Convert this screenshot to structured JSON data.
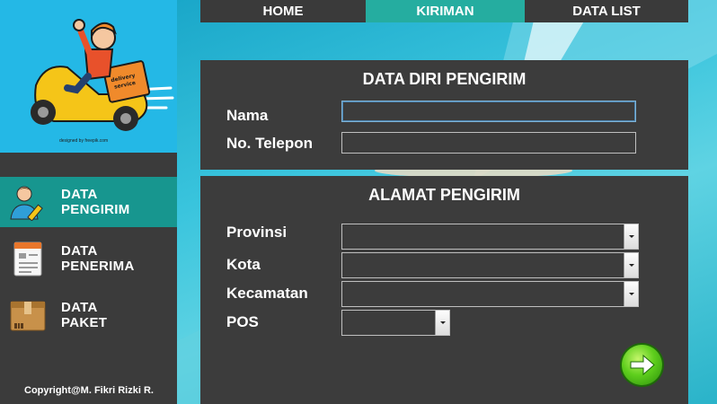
{
  "nav": {
    "tabs": [
      {
        "label": "HOME"
      },
      {
        "label": "KIRIMAN"
      },
      {
        "label": "DATA LIST"
      }
    ],
    "active_tab": "KIRIMAN"
  },
  "sidebar": {
    "hero": {
      "box_text": "delivery\nservice",
      "credit": "designed by freepik.com"
    },
    "items": [
      {
        "label": "DATA\nPENGIRIM",
        "icon": "user-edit-icon",
        "active": true
      },
      {
        "label": "DATA\nPENERIMA",
        "icon": "document-list-icon",
        "active": false
      },
      {
        "label": "DATA\nPAKET",
        "icon": "package-box-icon",
        "active": false
      }
    ],
    "copyright": "Copyright@M. Fikri Rizki R."
  },
  "form": {
    "data_diri": {
      "title": "DATA DIRI PENGIRIM",
      "nama_label": "Nama",
      "nama_value": "",
      "telepon_label": "No. Telepon",
      "telepon_value": ""
    },
    "alamat": {
      "title": "ALAMAT PENGIRIM",
      "provinsi_label": "Provinsi",
      "provinsi_value": "",
      "kota_label": "Kota",
      "kota_value": "",
      "kecamatan_label": "Kecamatan",
      "kecamatan_value": "",
      "pos_label": "POS",
      "pos_value": ""
    },
    "next_button_icon": "arrow-right-icon"
  },
  "colors": {
    "accent_teal": "#25ada0",
    "panel": "#3c3c3c",
    "sky": "#24b8e6",
    "next_green": "#5fcf1d"
  }
}
